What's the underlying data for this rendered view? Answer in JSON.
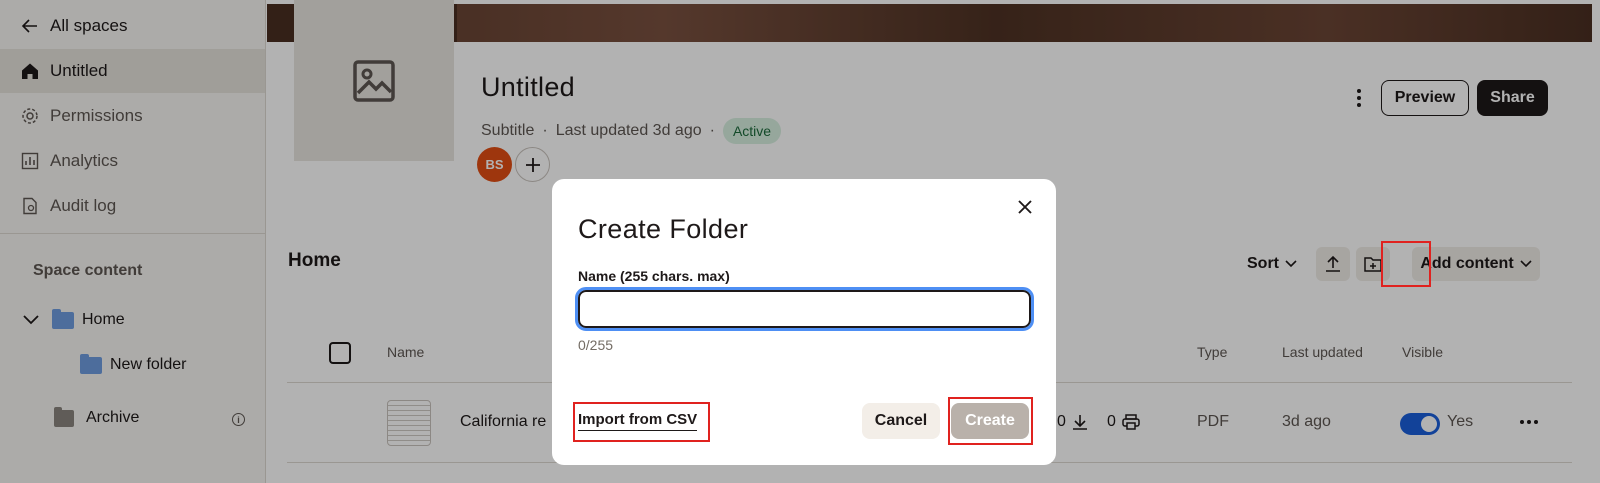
{
  "sidebar": {
    "back_label": "All spaces",
    "items": [
      {
        "label": "Untitled",
        "icon": "home-icon"
      },
      {
        "label": "Permissions",
        "icon": "gear-icon"
      },
      {
        "label": "Analytics",
        "icon": "chart-icon"
      },
      {
        "label": "Audit log",
        "icon": "document-icon"
      }
    ],
    "section_title": "Space content",
    "tree": {
      "home": "Home",
      "new_folder": "New folder",
      "archive": "Archive"
    }
  },
  "space": {
    "title": "Untitled",
    "subtitle": "Subtitle",
    "updated": "Last updated 3d ago",
    "status": "Active",
    "avatar_initials": "BS",
    "preview_label": "Preview",
    "share_label": "Share"
  },
  "content": {
    "title": "Home",
    "sort_label": "Sort",
    "add_content_label": "Add content",
    "columns": {
      "name": "Name",
      "type": "Type",
      "last_updated": "Last updated",
      "visible": "Visible"
    },
    "row": {
      "name": "California re",
      "downloads": "0",
      "prints": "0",
      "type": "PDF",
      "updated": "3d ago",
      "visible": "Yes"
    }
  },
  "modal": {
    "title": "Create Folder",
    "field_label": "Name (255 chars. max)",
    "input_value": "",
    "counter": "0/255",
    "import_label": "Import from CSV",
    "cancel_label": "Cancel",
    "create_label": "Create"
  },
  "colors": {
    "accent_blue": "#1a5fdc",
    "avatar_orange": "#e24e14",
    "highlight_red": "#e0221f",
    "status_green_bg": "#d7efe0"
  }
}
